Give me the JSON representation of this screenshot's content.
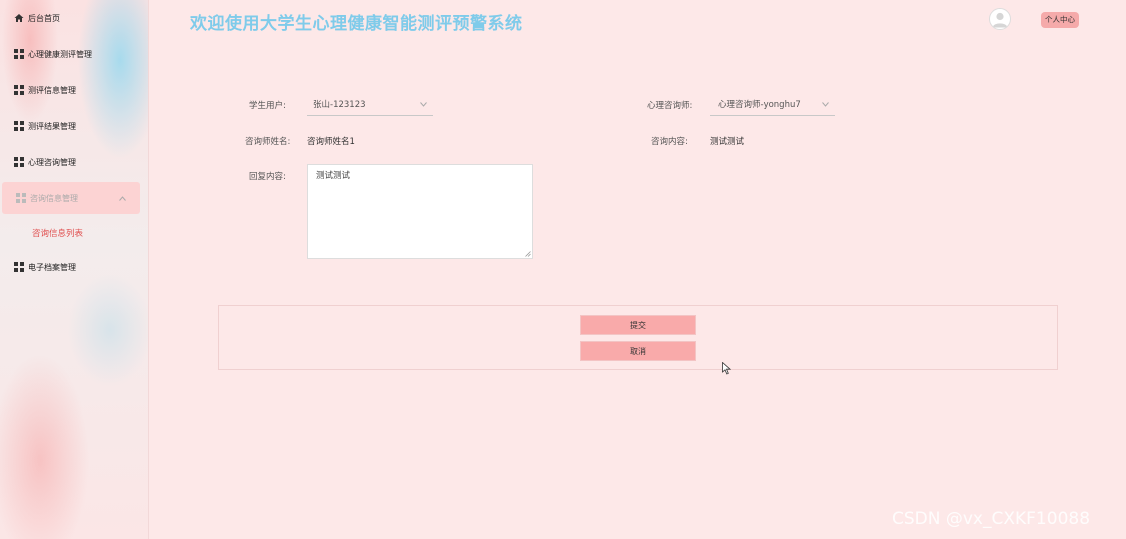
{
  "sidebar": {
    "items": [
      {
        "label": "后台首页",
        "icon": "home-icon"
      },
      {
        "label": "心理健康测评管理",
        "icon": "grid-icon"
      },
      {
        "label": "测评信息管理",
        "icon": "grid-icon"
      },
      {
        "label": "测评结果管理",
        "icon": "grid-icon"
      },
      {
        "label": "心理咨询管理",
        "icon": "grid-icon"
      },
      {
        "label": "咨询信息管理",
        "icon": "grid-icon",
        "expanded": true
      },
      {
        "label": "电子档案管理",
        "icon": "grid-icon"
      }
    ],
    "sub_item": "咨询信息列表"
  },
  "header": {
    "title": "欢迎使用大学生心理健康智能测评预警系统",
    "profile_button": "个人中心"
  },
  "form": {
    "student_label": "学生用户:",
    "student_value": "张山-123123",
    "counselor_label": "心理咨询师:",
    "counselor_value": "心理咨询师-yonghu7",
    "counselor_name_label": "咨询师姓名:",
    "counselor_name_value": "咨询师姓名1",
    "content_label": "咨询内容:",
    "content_value": "测试测试",
    "reply_label": "回复内容:",
    "reply_value": "测试测试",
    "submit_label": "提交",
    "cancel_label": "取消"
  },
  "watermark": "CSDN @vx_CXKF10088",
  "colors": {
    "title": "#7fcbea",
    "accent_button": "#f9aaaa",
    "background": "#fde8e8",
    "active_sub": "#e05050"
  }
}
